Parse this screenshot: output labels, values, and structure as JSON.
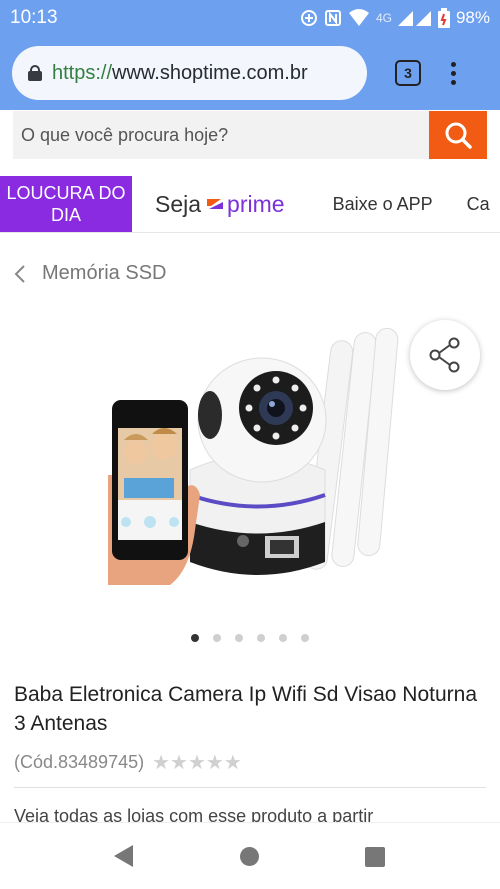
{
  "status_bar": {
    "time": "10:13",
    "network": "4G",
    "battery": "98%"
  },
  "browser": {
    "url_scheme": "https://",
    "url_rest": "www.shoptime.com.br",
    "tab_count": "3"
  },
  "search": {
    "placeholder": "O que você procura hoje?"
  },
  "nav": {
    "loucura": "LOUCURA DO DIA",
    "seja": "Seja",
    "prime": "prime",
    "app": "Baixe o APP",
    "cut": "Ca"
  },
  "breadcrumb": {
    "label": "Memória SSD"
  },
  "product": {
    "title": "Baba Eletronica Camera Ip Wifi Sd Visao Noturna 3 Antenas",
    "code": "(Cód.83489745)",
    "stars": "★★★★★",
    "dots_total": 6,
    "dots_active": 0,
    "partial_text": "Veja todas as lojas com esse produto a partir"
  },
  "colors": {
    "brand_orange": "#f25b14",
    "prime_purple": "#7b32d8",
    "loucura_bg": "#8a2be2",
    "status_blue": "#6ea0f0"
  }
}
